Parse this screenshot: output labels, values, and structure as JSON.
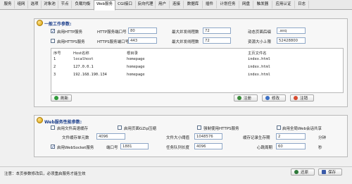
{
  "tabs": [
    "服务",
    "组网",
    "选项",
    "对象池",
    "节点",
    "负载均衡",
    "Web服务",
    "CGI接口",
    "反向代理",
    "用户",
    "连接",
    "数据库",
    "插件",
    "计划任务",
    "网盘",
    "触发器",
    "应用认证",
    "日志"
  ],
  "active_tab": "Web服务",
  "general": {
    "title": "一般工作参数:",
    "http_enable_label": "启用HTTP服务",
    "http_port_label": "HTTP服务端口号",
    "http_port": "80",
    "http_max_conn_label": "最大并发线程数",
    "http_max_conn": "72",
    "dynamic_ext_label": "动态页面后缀",
    "dynamic_ext": ".asq",
    "https_enable_label": "启用HTTPS服务",
    "https_port_label": "HTTPS服务端口号",
    "https_port": "443",
    "https_max_conn_label": "最大并发线程数",
    "https_max_conn": "72",
    "resource_limit_label": "资源大小上限",
    "resource_limit": "52428800"
  },
  "table": {
    "headers": [
      "序号",
      "Host名称",
      "根目录",
      "主页文件名"
    ],
    "rows": [
      {
        "no": "1",
        "host": "localhost",
        "root": "homepage",
        "index": "index.html"
      },
      {
        "no": "2",
        "host": "127.0.0.1",
        "root": "homepage",
        "index": "index.html"
      },
      {
        "no": "3",
        "host": "192.168.190.134",
        "root": "homepage",
        "index": "index.html"
      }
    ]
  },
  "buttons": {
    "refresh": "刷新",
    "register": "注册",
    "modify": "修改",
    "unregister": "注销",
    "restore": "还原",
    "save": "保存"
  },
  "perf": {
    "title": "Web服务性能参数:",
    "enable_fast_cache_label": "启用文件高速缓存",
    "enable_gzip_label": "启用页面GZip压缩",
    "force_https_label": "强制使用HTTPS服务",
    "enable_web_share_label": "启用全局Web会话共享",
    "cache_units_label": "文件缓存单元数",
    "cache_units": "4096",
    "file_size_threshold_label": "文件大小阈值",
    "file_size_threshold": "1048576",
    "cache_lifetime_label": "缓存记录生存期",
    "cache_lifetime": "2",
    "cache_lifetime_unit": "分钟",
    "websocket_label": "启用WebSocket服务",
    "ws_port_label": "端口号",
    "ws_port": "1881",
    "queue_len_label": "任务队列长度",
    "queue_len": "4096",
    "heartbeat_label": "心跳周期",
    "heartbeat": "60",
    "heartbeat_unit": "秒"
  },
  "status_note": "注意：本页参数修改后，必须重启服务才能生效"
}
